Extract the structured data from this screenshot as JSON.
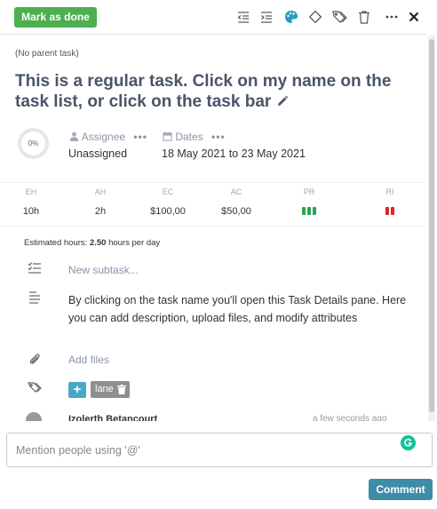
{
  "toolbar": {
    "mark_done_label": "Mark as done",
    "icons": [
      "outdent-icon",
      "indent-icon",
      "palette-icon",
      "milestone-icon",
      "tags-icon",
      "trash-icon",
      "more-icon",
      "close-icon"
    ],
    "accent_color": "#4caf50"
  },
  "task": {
    "parent": "(No parent task)",
    "title": "This is a regular task. Click on my name on the task list, or click on the task bar",
    "progress": "0%"
  },
  "assignee": {
    "label": "Assignee",
    "more": "•••",
    "value": "Unassigned"
  },
  "dates": {
    "label": "Dates",
    "more": "•••",
    "value": "18 May 2021 to 23 May 2021"
  },
  "stats": [
    {
      "header": "EH",
      "value": "10h"
    },
    {
      "header": "AH",
      "value": "2h"
    },
    {
      "header": "EC",
      "value": "$100,00"
    },
    {
      "header": "AC",
      "value": "$50,00"
    },
    {
      "header": "PR",
      "bars": 3,
      "color": "#2ea44f"
    },
    {
      "header": "RI",
      "bars": 2,
      "color": "#e02424"
    }
  ],
  "estimated": {
    "label": "Estimated hours:",
    "value": "2.50",
    "suffix": "hours per day"
  },
  "subtask": {
    "placeholder": "New subtask..."
  },
  "description": "By clicking on the task name you'll open this Task Details pane. Here you can add description, upload files, and modify attributes",
  "files": {
    "label": "Add files"
  },
  "tags": {
    "add_symbol": "+",
    "items": [
      {
        "name": "lane"
      }
    ]
  },
  "comment_preview": {
    "author": "Izolerth Betancourt",
    "time": "a few seconds ago"
  },
  "comment_box": {
    "placeholder": "Mention people using '@'",
    "submit_label": "Comment",
    "submit_color": "#3d8ca8"
  }
}
